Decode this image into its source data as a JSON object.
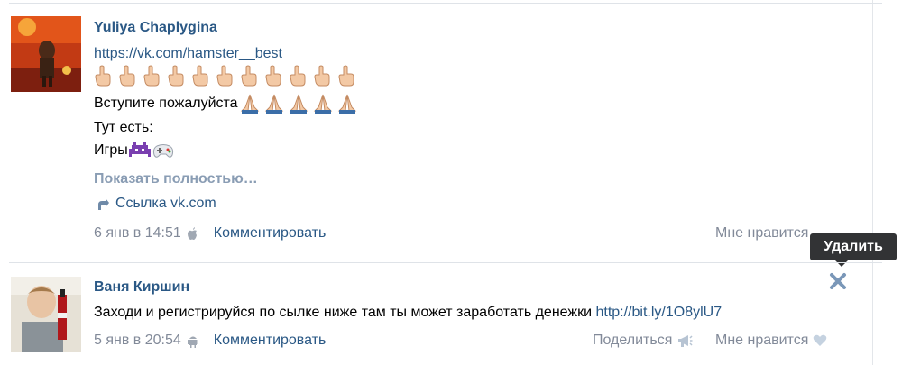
{
  "posts": [
    {
      "author": "Yuliya Chaplygina",
      "link": "https://vk.com/hamster__best",
      "line_join": "Вступите пожалуйста",
      "line_here": "Тут есть:",
      "line_games": "Игры",
      "show_more": "Показать полностью…",
      "attachment": "Ссылка vk.com",
      "date": "6 янв в 14:51",
      "comment": "Комментировать",
      "like": "Мне нравится"
    },
    {
      "author": "Ваня Киршин",
      "text": "Заходи и регистрируйся по сылке ниже там ты может заработать денежки",
      "text_link": "http://bit.ly/1O8ylU7",
      "date": "5 янв в 20:54",
      "comment": "Комментировать",
      "share": "Поделиться",
      "like": "Мне нравится"
    }
  ],
  "tooltip": "Удалить",
  "icons": {
    "pointing_hand": "hand-pointing-up-icon",
    "praying_hands": "praying-hands-icon",
    "apple": "apple-icon",
    "android": "android-icon",
    "share": "megaphone-icon",
    "like": "heart-icon",
    "delete": "close-icon"
  },
  "colors": {
    "link": "#2a5885",
    "muted": "#828a99",
    "more": "#8a9db4",
    "tooltip_bg": "#323335"
  }
}
